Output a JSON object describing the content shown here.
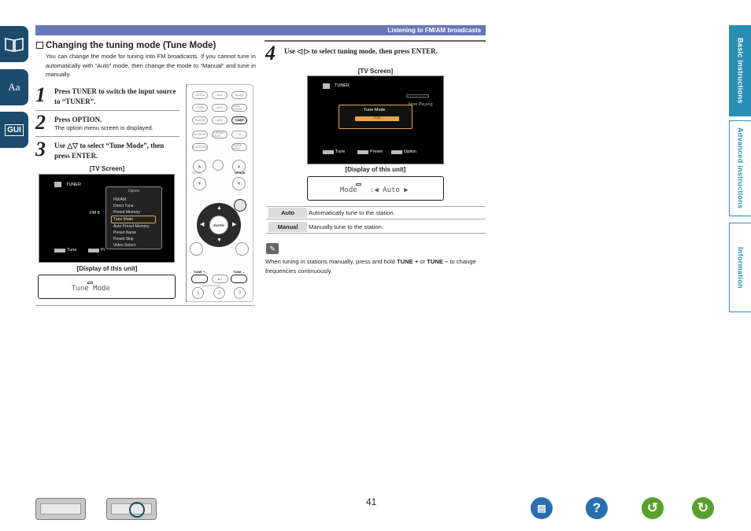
{
  "header": {
    "section": "Listening to FM/AM broadcasts"
  },
  "side_tabs": [
    {
      "label": "Basic instructions",
      "active": true
    },
    {
      "label": "Advanced instructions",
      "active": false
    },
    {
      "label": "Information",
      "active": false
    }
  ],
  "left_nav": [
    {
      "icon": "book-icon"
    },
    {
      "icon": "glossary-icon",
      "text": "Aa"
    },
    {
      "icon": "gui-icon",
      "text": "GUI"
    }
  ],
  "section": {
    "title": "Changing the tuning mode (Tune Mode)",
    "intro": "You can change the mode for tuning into FM broadcasts. If you cannot tune in automatically with “Auto” mode, then change the mode to “Manual” and tune in manually."
  },
  "steps": [
    {
      "num": "1",
      "text": "Press TUNER to switch the input source to “TUNER”.",
      "sub": ""
    },
    {
      "num": "2",
      "text": "Press OPTION.",
      "sub": "The option menu screen is displayed."
    },
    {
      "num": "3",
      "text": "Use △▽ to select “Tune Mode”, then press ENTER.",
      "sub": ""
    },
    {
      "num": "4",
      "text": "Use ◁ ▷ to select tuning mode, then press ENTER.",
      "sub": ""
    }
  ],
  "screen1": {
    "caption": "[TV Screen]",
    "source": "TUNER",
    "band_partial": "FM 8",
    "menu_title": "Option",
    "menu_items": [
      "FM/AM",
      "Direct Tune",
      "Preset Memory",
      "Tune Mode",
      "Auto Preset Memory",
      "Preset Name",
      "Preset Skip",
      "Video Select"
    ],
    "selected_index": 3,
    "footer": [
      "Tune",
      "Pr"
    ],
    "display_caption": "[Display of this unit]",
    "display_text": "Tune Mode"
  },
  "screen2": {
    "caption": "[TV Screen]",
    "source": "TUNER",
    "now_playing": "Now Playing",
    "dialog_title": "Tune Mode",
    "dialog_value": "Auto",
    "footer": [
      "Tune",
      "Preset",
      "Option"
    ],
    "display_caption": "[Display of this unit]",
    "display_text": "Mode   :◀ Auto ▶"
  },
  "remote": {
    "buttons_top": [
      "CBL/SAT",
      "DVD",
      "Blu-ray",
      "GAME",
      "AUX1",
      "MEDIA PLAYER",
      "iPod/USB",
      "AUX2",
      "TUNER",
      "NETWORK",
      "INTERNET RADIO",
      "TV",
      "BLUETOOTH",
      "ONLINE MUSIC"
    ],
    "highlight": "TUNER",
    "labels": [
      "SETUP",
      "OPTION",
      "ENTER",
      "INFO",
      "BACK",
      "TUNE +",
      "TUNE –",
      "CHANNEL/PAGE"
    ]
  },
  "table": [
    {
      "key": "Auto",
      "value": "Automatically tune to the station."
    },
    {
      "key": "Manual",
      "value": "Manually tune to the station."
    }
  ],
  "note": {
    "pre": "When tuning in stations manually, press and hold ",
    "b1": "TUNE +",
    "mid": " or ",
    "b2": "TUNE –",
    "post": " to change frequencies continuously."
  },
  "page_number": "41",
  "bottom_nav": [
    "front-panel-button",
    "display-button",
    "contents-button",
    "help-button",
    "back-button",
    "forward-button"
  ],
  "colors": {
    "tab": "#2a8fb4",
    "header": "#6878b8",
    "nav": "#1c4b6e",
    "green": "#5aa02c"
  }
}
